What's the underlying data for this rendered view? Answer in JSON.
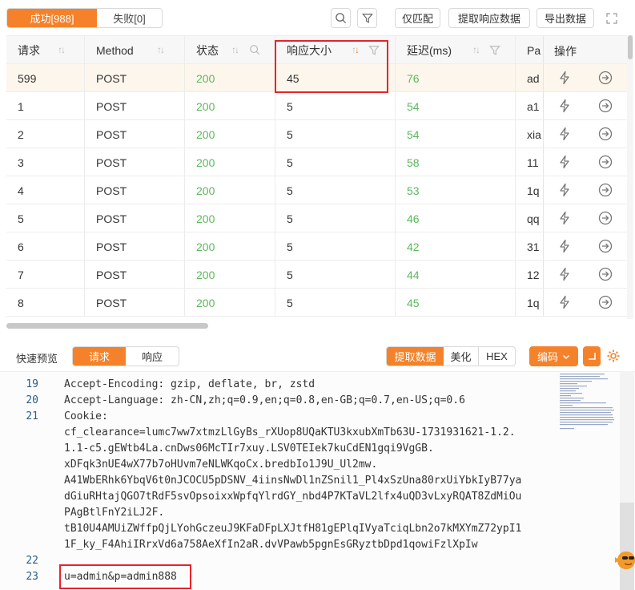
{
  "toolbar": {
    "success_tab": "成功[988]",
    "fail_tab": "失败[0]",
    "match_only": "仅匹配",
    "extract_response": "提取响应数据",
    "export_data": "导出数据"
  },
  "table": {
    "columns": [
      "请求",
      "Method",
      "状态",
      "响应大小",
      "延迟(ms)",
      "Pa"
    ],
    "actions_label": "操作",
    "rows": [
      {
        "id": "599",
        "method": "POST",
        "status": "200",
        "size": "45",
        "latency": "76",
        "payload": "ad"
      },
      {
        "id": "1",
        "method": "POST",
        "status": "200",
        "size": "5",
        "latency": "54",
        "payload": "a1"
      },
      {
        "id": "2",
        "method": "POST",
        "status": "200",
        "size": "5",
        "latency": "54",
        "payload": "xia"
      },
      {
        "id": "3",
        "method": "POST",
        "status": "200",
        "size": "5",
        "latency": "58",
        "payload": "11"
      },
      {
        "id": "4",
        "method": "POST",
        "status": "200",
        "size": "5",
        "latency": "53",
        "payload": "1q"
      },
      {
        "id": "5",
        "method": "POST",
        "status": "200",
        "size": "5",
        "latency": "46",
        "payload": "qq"
      },
      {
        "id": "6",
        "method": "POST",
        "status": "200",
        "size": "5",
        "latency": "42",
        "payload": "31"
      },
      {
        "id": "7",
        "method": "POST",
        "status": "200",
        "size": "5",
        "latency": "44",
        "payload": "12"
      },
      {
        "id": "8",
        "method": "POST",
        "status": "200",
        "size": "5",
        "latency": "45",
        "payload": "1q"
      }
    ],
    "selected_row": 0
  },
  "preview": {
    "label": "快速预览",
    "request_tab": "请求",
    "response_tab": "响应",
    "extract": "提取数据",
    "beautify": "美化",
    "hex": "HEX",
    "encode": "编码"
  },
  "code": {
    "lines": [
      {
        "num": "19",
        "text": "Accept-Encoding: gzip, deflate, br, zstd"
      },
      {
        "num": "20",
        "text": "Accept-Language: zh-CN,zh;q=0.9,en;q=0.8,en-GB;q=0.7,en-US;q=0.6"
      },
      {
        "num": "21",
        "text": "Cookie: "
      },
      {
        "num": "",
        "text": "cf_clearance=lumc7ww7xtmzLlGyBs_rXUop8UQaKTU3kxubXmTb63U-1731931621-1.2."
      },
      {
        "num": "",
        "text": "1.1-c5.gEWtb4La.cnDws06McTIr7xuy.LSV0TEIek7kuCdEN1gqi9VgGB."
      },
      {
        "num": "",
        "text": "xDFqk3nUE4wX77b7oHUvm7eNLWKqoCx.bredbIo1J9U_Ul2mw."
      },
      {
        "num": "",
        "text": "A41WbERhk6YbqV6t0nJCOCU5pDSNV_4iinsNwDl1nZSnil1_Pl4xSzUna80rxUiYbkIyB77ya"
      },
      {
        "num": "",
        "text": "dGiuRHtajQGO7tRdF5svOpsoixxWpfqYlrdGY_nbd4P7KTaVL2lfx4uQD3vLxyRQAT8ZdMiOu"
      },
      {
        "num": "",
        "text": "PAgBtlFnY2iLJ2F."
      },
      {
        "num": "",
        "text": "tB10U4AMUiZWffpQjLYohGczeuJ9KFaDFpLXJtfH81gEPlqIVyaTciqLbn2o7kMXYmZ72ypI1"
      },
      {
        "num": "",
        "text": "1F_ky_F4AhiIRrxVd6a758AeXfIn2aR.dvVPawb5pgnEsGRyztbDpd1qowiFzlXpIw"
      },
      {
        "num": "22",
        "text": ""
      },
      {
        "num": "23",
        "text": "u=admin&p=admin888"
      }
    ]
  },
  "colors": {
    "accent": "#f5822a",
    "status_ok": "#5cb85c",
    "highlight": "#e8232a",
    "selected_row_bg": "#fdf6ec"
  }
}
